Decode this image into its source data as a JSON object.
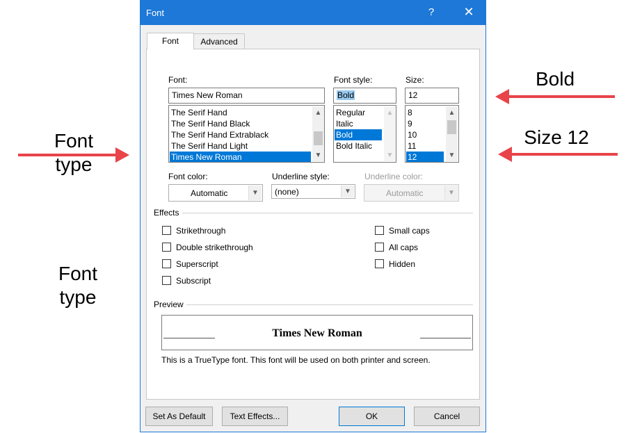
{
  "dialog": {
    "title": "Font",
    "help_glyph": "?",
    "close_glyph": "✕",
    "tabs": [
      {
        "label": "Font",
        "active": true
      },
      {
        "label": "Advanced",
        "active": false
      }
    ]
  },
  "font_section": {
    "label": "Font:",
    "value": "Times New Roman",
    "items": [
      "The Serif Hand",
      "The Serif Hand Black",
      "The Serif Hand Extrablack",
      "The Serif Hand Light",
      "Times New Roman"
    ],
    "selected": "Times New Roman"
  },
  "style_section": {
    "label": "Font style:",
    "value": "Bold",
    "items": [
      "Regular",
      "Italic",
      "Bold",
      "Bold Italic"
    ],
    "selected": "Bold"
  },
  "size_section": {
    "label": "Size:",
    "value": "12",
    "items": [
      "8",
      "9",
      "10",
      "11",
      "12"
    ],
    "selected": "12"
  },
  "font_color": {
    "label": "Font color:",
    "value": "Automatic"
  },
  "underline_style": {
    "label": "Underline style:",
    "value": "(none)"
  },
  "underline_color": {
    "label": "Underline color:",
    "value": "Automatic",
    "disabled": true
  },
  "effects": {
    "label": "Effects",
    "left": [
      {
        "label": "Strikethrough",
        "checked": false
      },
      {
        "label": "Double strikethrough",
        "checked": false
      },
      {
        "label": "Superscript",
        "checked": false
      },
      {
        "label": "Subscript",
        "checked": false
      }
    ],
    "right": [
      {
        "label": "Small caps",
        "checked": false
      },
      {
        "label": "All caps",
        "checked": false
      },
      {
        "label": "Hidden",
        "checked": false
      }
    ]
  },
  "preview": {
    "label": "Preview",
    "sample": "Times New Roman",
    "note": "This is a TrueType font. This font will be used on both printer and screen."
  },
  "buttons": {
    "set_default": "Set As Default",
    "text_effects": "Text Effects...",
    "ok": "OK",
    "cancel": "Cancel"
  },
  "annotations": {
    "bold": "Bold",
    "size": "Size 12",
    "font_type_1_line1": "Font",
    "font_type_1_line2": "type",
    "font_type_2_line1": "Font",
    "font_type_2_line2": "type",
    "arrow_color": "#e8444a"
  },
  "colors": {
    "title_bar": "#1e78d7",
    "selection": "#0078d7"
  }
}
